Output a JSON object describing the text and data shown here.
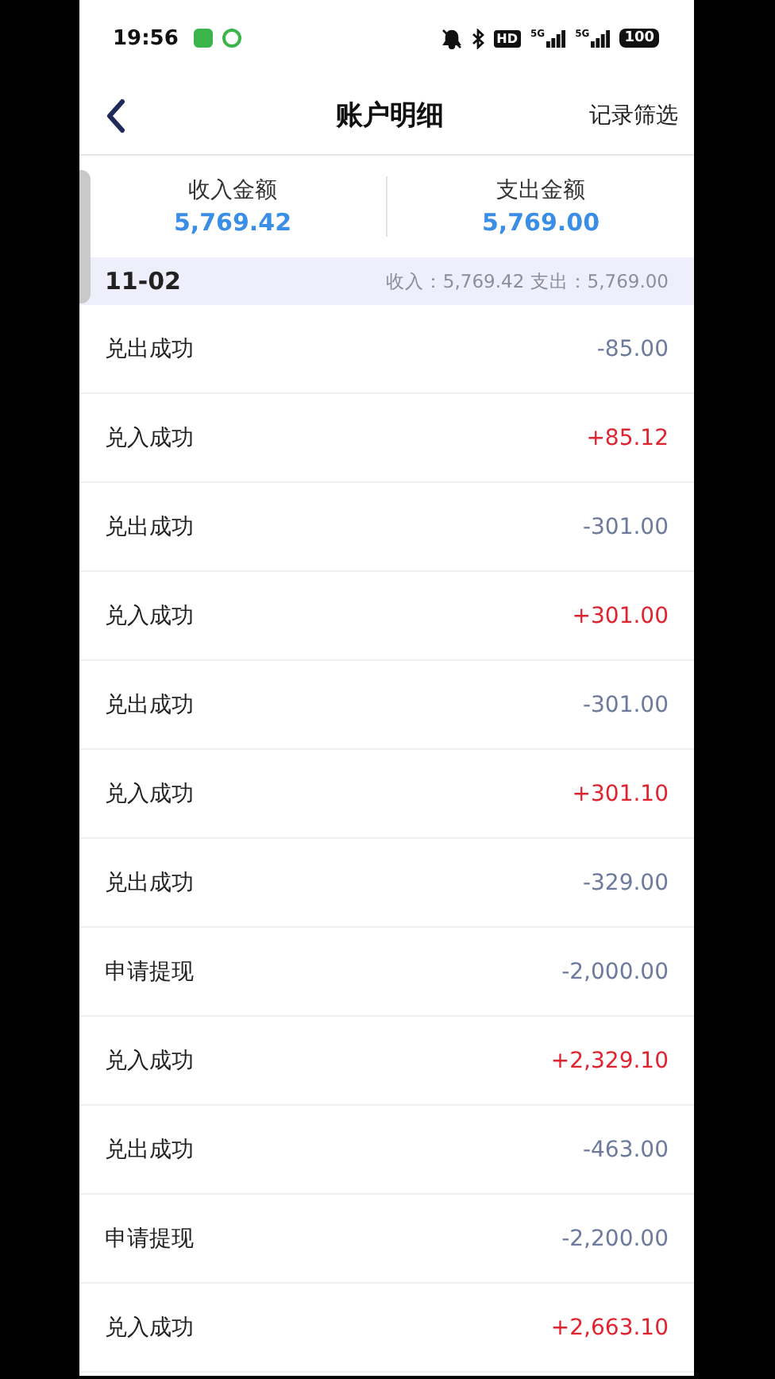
{
  "status_bar": {
    "time": "19:56",
    "hd": "HD",
    "signals": [
      "5G",
      "5G"
    ],
    "battery": "100"
  },
  "nav": {
    "title": "账户明细",
    "action": "记录筛选"
  },
  "summary": [
    {
      "label": "收入金额",
      "value": "5,769.42"
    },
    {
      "label": "支出金额",
      "value": "5,769.00"
    }
  ],
  "date_header": {
    "date": "11-02",
    "totals": "收入：5,769.42 支出：5,769.00"
  },
  "rows": [
    {
      "title": "兑出成功",
      "amount": "-85.00",
      "kind": "expense"
    },
    {
      "title": "兑入成功",
      "amount": "+85.12",
      "kind": "income"
    },
    {
      "title": "兑出成功",
      "amount": "-301.00",
      "kind": "expense"
    },
    {
      "title": "兑入成功",
      "amount": "+301.00",
      "kind": "income"
    },
    {
      "title": "兑出成功",
      "amount": "-301.00",
      "kind": "expense"
    },
    {
      "title": "兑入成功",
      "amount": "+301.10",
      "kind": "income"
    },
    {
      "title": "兑出成功",
      "amount": "-329.00",
      "kind": "expense"
    },
    {
      "title": "申请提现",
      "amount": "-2,000.00",
      "kind": "expense"
    },
    {
      "title": "兑入成功",
      "amount": "+2,329.10",
      "kind": "income"
    },
    {
      "title": "兑出成功",
      "amount": "-463.00",
      "kind": "expense"
    },
    {
      "title": "申请提现",
      "amount": "-2,200.00",
      "kind": "expense"
    },
    {
      "title": "兑入成功",
      "amount": "+2,663.10",
      "kind": "income"
    }
  ]
}
